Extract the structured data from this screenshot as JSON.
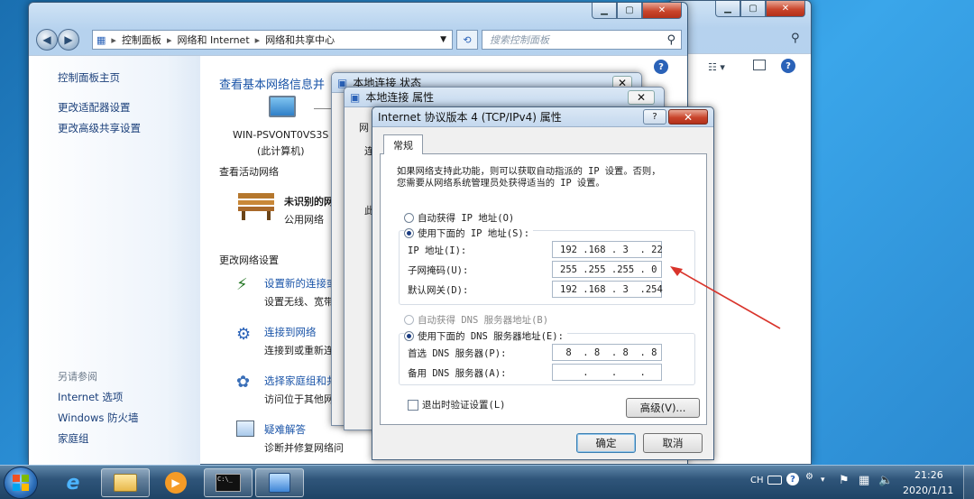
{
  "explorer": {
    "breadcrumb": [
      "控制面板",
      "网络和 Internet",
      "网络和共享中心"
    ],
    "search_placeholder": "搜索控制面板",
    "sidebar_top": [
      "控制面板主页",
      "更改适配器设置",
      "更改高级共享设置"
    ],
    "see_also_title": "另请参阅",
    "see_also": [
      "Internet 选项",
      "Windows 防火墙",
      "家庭组"
    ],
    "main_title": "查看基本网络信息并",
    "computer_name": "WIN-PSVONT0VS3S",
    "computer_sub": "(此计算机)",
    "active_networks": "查看活动网络",
    "network_name": "未识别的网",
    "network_type": "公用网络",
    "change_settings": "更改网络设置",
    "tasks": [
      {
        "title": "设置新的连接或",
        "desc": "设置无线、宽带"
      },
      {
        "title": "连接到网络",
        "desc": "连接到或重新连"
      },
      {
        "title": "选择家庭组和共",
        "desc": "访问位于其他网"
      },
      {
        "title": "疑难解答",
        "desc": "诊断并修复网络问"
      }
    ]
  },
  "status_dialog": {
    "title": "本地连接 状态"
  },
  "props_dialog": {
    "title": "本地连接 属性",
    "tab_fragment": "网",
    "frag1": "连",
    "frag2": "此"
  },
  "ipv4": {
    "title": "Internet 协议版本 4 (TCP/IPv4) 属性",
    "help": "?",
    "tab": "常规",
    "desc1": "如果网络支持此功能，则可以获取自动指派的 IP 设置。否则，",
    "desc2": "您需要从网络系统管理员处获得适当的 IP 设置。",
    "auto_ip": "自动获得 IP 地址(O)",
    "use_ip": "使用下面的 IP 地址(S):",
    "ip_label": "IP 地址(I):",
    "ip_value": "192 .168 . 3  . 22",
    "mask_label": "子网掩码(U):",
    "mask_value": "255 .255 .255 . 0",
    "gw_label": "默认网关(D):",
    "gw_value": "192 .168 . 3  .254",
    "auto_dns": "自动获得 DNS 服务器地址(B)",
    "use_dns": "使用下面的 DNS 服务器地址(E):",
    "dns1_label": "首选 DNS 服务器(P):",
    "dns1_value": " 8  . 8  . 8  . 8",
    "dns2_label": "备用 DNS 服务器(A):",
    "dns2_value": "    .    .    .",
    "validate": "退出时验证设置(L)",
    "advanced": "高级(V)...",
    "ok": "确定",
    "cancel": "取消"
  },
  "taskbar": {
    "lang": "CH",
    "time": "21:26",
    "date": "2020/1/11"
  },
  "colors": {
    "annotation_arrow": "#d9342b",
    "link": "#1a54a8"
  }
}
